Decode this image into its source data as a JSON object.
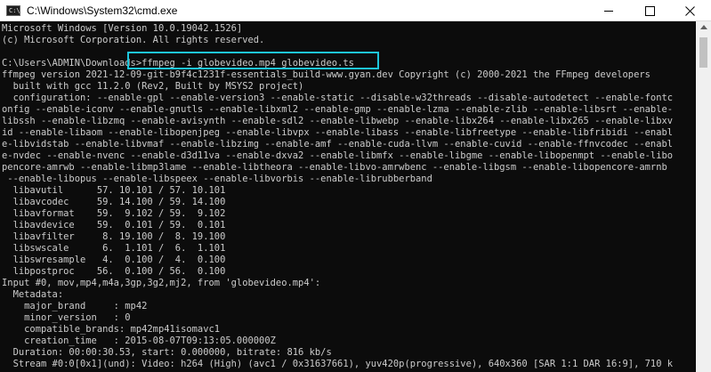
{
  "window": {
    "title": "C:\\Windows\\System32\\cmd.exe",
    "icon_name": "cmd-icon",
    "icon_text": "C:\\",
    "controls": [
      "minimize-icon",
      "maximize-icon",
      "close-icon"
    ]
  },
  "console": {
    "lines": [
      "Microsoft Windows [Version 10.0.19042.1526]",
      "(c) Microsoft Corporation. All rights reserved.",
      "",
      "C:\\Users\\ADMIN\\Downloads>ffmpeg -i globevideo.mp4 globevideo.ts",
      "ffmpeg version 2021-12-09-git-b9f4c1231f-essentials_build-www.gyan.dev Copyright (c) 2000-2021 the FFmpeg developers",
      "  built with gcc 11.2.0 (Rev2, Built by MSYS2 project)",
      "  configuration: --enable-gpl --enable-version3 --enable-static --disable-w32threads --disable-autodetect --enable-fontc",
      "onfig --enable-iconv --enable-gnutls --enable-libxml2 --enable-gmp --enable-lzma --enable-zlib --enable-libsrt --enable-",
      "libssh --enable-libzmq --enable-avisynth --enable-sdl2 --enable-libwebp --enable-libx264 --enable-libx265 --enable-libxv",
      "id --enable-libaom --enable-libopenjpeg --enable-libvpx --enable-libass --enable-libfreetype --enable-libfribidi --enabl",
      "e-libvidstab --enable-libvmaf --enable-libzimg --enable-amf --enable-cuda-llvm --enable-cuvid --enable-ffnvcodec --enabl",
      "e-nvdec --enable-nvenc --enable-d3d11va --enable-dxva2 --enable-libmfx --enable-libgme --enable-libopenmpt --enable-libo",
      "pencore-amrwb --enable-libmp3lame --enable-libtheora --enable-libvo-amrwbenc --enable-libgsm --enable-libopencore-amrnb",
      " --enable-libopus --enable-libspeex --enable-libvorbis --enable-librubberband",
      "  libavutil      57. 10.101 / 57. 10.101",
      "  libavcodec     59. 14.100 / 59. 14.100",
      "  libavformat    59.  9.102 / 59.  9.102",
      "  libavdevice    59.  0.101 / 59.  0.101",
      "  libavfilter     8. 19.100 /  8. 19.100",
      "  libswscale      6.  1.101 /  6.  1.101",
      "  libswresample   4.  0.100 /  4.  0.100",
      "  libpostproc    56.  0.100 / 56.  0.100",
      "Input #0, mov,mp4,m4a,3gp,3g2,mj2, from 'globevideo.mp4':",
      "  Metadata:",
      "    major_brand     : mp42",
      "    minor_version   : 0",
      "    compatible_brands: mp42mp41isomavc1",
      "    creation_time   : 2015-08-07T09:13:05.000000Z",
      "  Duration: 00:00:30.53, start: 0.000000, bitrate: 816 kb/s",
      "  Stream #0:0[0x1](und): Video: h264 (High) (avc1 / 0x31637661), yuv420p(progressive), 640x360 [SAR 1:1 DAR 16:9], 710 k"
    ]
  },
  "colors": {
    "background": "#0c0c0c",
    "text": "#cccccc",
    "highlight": "#1ec6dc",
    "titlebar": "#ffffff"
  }
}
